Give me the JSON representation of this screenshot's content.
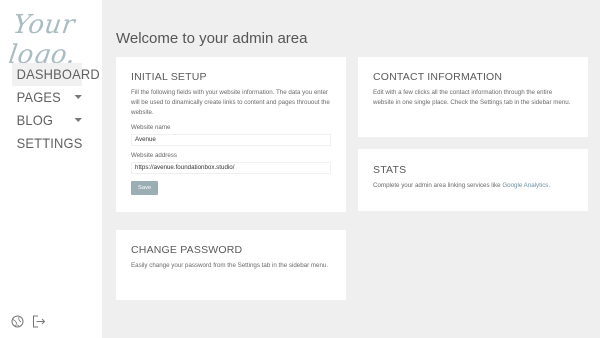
{
  "sidebar": {
    "logo_text": "Your logo.",
    "nav": [
      {
        "label": "DASHBOARD",
        "active": true,
        "has_submenu": false
      },
      {
        "label": "PAGES",
        "active": false,
        "has_submenu": true
      },
      {
        "label": "BLOG",
        "active": false,
        "has_submenu": true
      },
      {
        "label": "SETTINGS",
        "active": false,
        "has_submenu": false
      }
    ],
    "bottom_icons": [
      "globe-icon",
      "logout-icon"
    ]
  },
  "main": {
    "title": "Welcome to your admin area",
    "initial_setup": {
      "title": "INITIAL SETUP",
      "description": "Fill the following fields with your website information. The data you enter will be used to dinamically create links to content and pages throuout the website.",
      "website_name_label": "Website name",
      "website_name_value": "Avenue",
      "website_address_label": "Website address",
      "website_address_value": "https://avenue.foundationbox.studio/",
      "save_label": "Save"
    },
    "contact_information": {
      "title": "CONTACT INFORMATION",
      "description": "Edit with a few clicks all the contact information through the entire website in one single place. Check the Settings tab in the sidebar menu."
    },
    "stats": {
      "title": "STATS",
      "description_prefix": "Complete your admin area linking services like ",
      "link_text": "Google Analytics",
      "description_suffix": "."
    },
    "change_password": {
      "title": "CHANGE PASSWORD",
      "description": "Easily change your password from the Settings tab in the sidebar menu."
    }
  },
  "colors": {
    "background": "#efefef",
    "sidebar": "#ffffff",
    "accent": "#9aaeb4",
    "logo": "#a9bcc2"
  }
}
